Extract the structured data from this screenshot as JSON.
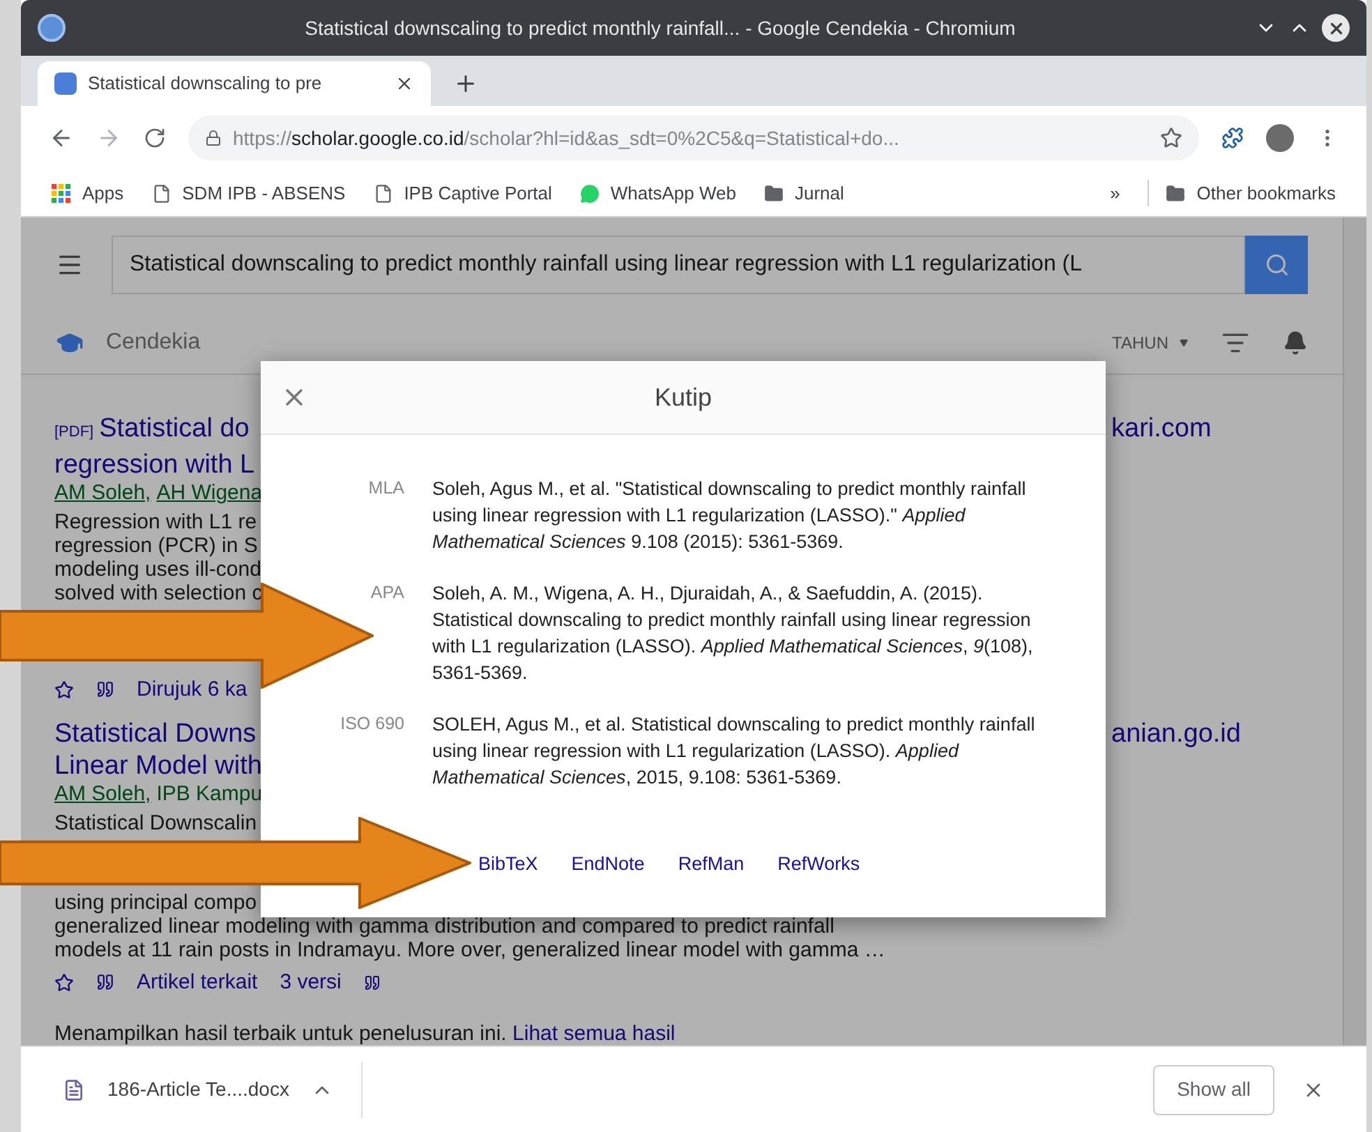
{
  "window": {
    "title": "Statistical downscaling to predict monthly rainfall... - Google Cendekia - Chromium"
  },
  "tabs": [
    {
      "label": "Statistical downscaling to pre",
      "selected": true
    }
  ],
  "address_bar": {
    "scheme": "https://",
    "host": "scholar.google.co.id",
    "path": "/scholar?hl=id&as_sdt=0%2C5&q=Statistical+do..."
  },
  "bookmarks": [
    {
      "kind": "apps",
      "label": "Apps"
    },
    {
      "kind": "page",
      "label": "SDM IPB - ABSENS"
    },
    {
      "kind": "page",
      "label": "IPB Captive Portal"
    },
    {
      "kind": "chat",
      "label": "WhatsApp Web"
    },
    {
      "kind": "folder",
      "label": "Jurnal"
    }
  ],
  "bookmarks_overflow": "»",
  "other_bookmarks": "Other bookmarks",
  "search": {
    "value": "Statistical downscaling to predict monthly rainfall using linear regression with L1 regularization (L"
  },
  "brand": "Cendekia",
  "year_filter": "TAHUN",
  "results": [
    {
      "pdf_tag": "[PDF]",
      "title_lines": [
        "Statistical do",
        "regression with L"
      ],
      "source": "kari.com",
      "authors": [
        {
          "name": "AM Soleh,",
          "link": true
        },
        {
          "name": "AH Wigena",
          "link": true
        }
      ],
      "snippet_blocks": [
        [
          "Regression with L1 re",
          "regression (PCR) in S",
          "modeling uses ill-cond",
          "solved with selection c"
        ]
      ],
      "actions": [
        "Dirujuk 6 ka"
      ]
    },
    {
      "title_lines": [
        "Statistical Downs",
        "Linear Model with"
      ],
      "source": "anian.go.id",
      "authors": [
        {
          "name": "AM Soleh,",
          "link": true
        },
        {
          "name": "IPB Kampu",
          "link": false
        }
      ],
      "snippet_blocks": [
        [
          "Statistical Downscalin"
        ],
        [
          "using principal compo",
          "generalized linear modeling with gamma distribution and compared to predict rainfall",
          "models at 11 rain posts in Indramayu. More over, generalized linear model with gamma …"
        ]
      ],
      "actions": [
        "Artikel terkait",
        "3 versi"
      ]
    }
  ],
  "footer": {
    "text": "Menampilkan hasil terbaik untuk penelusuran ini.",
    "link": "Lihat semua hasil"
  },
  "dialog": {
    "title": "Kutip",
    "citations": [
      {
        "style": "MLA",
        "text": "Soleh, Agus M., et al. \"Statistical downscaling to predict monthly rainfall using linear regression with L1 regularization (LASSO).\" *Applied Mathematical Sciences* 9.108 (2015): 5361-5369."
      },
      {
        "style": "APA",
        "text": "Soleh, A. M., Wigena, A. H., Djuraidah, A., & Saefuddin, A. (2015). Statistical downscaling to predict monthly rainfall using linear regression with L1 regularization (LASSO). *Applied Mathematical Sciences*, *9*(108), 5361-5369."
      },
      {
        "style": "ISO 690",
        "text": "SOLEH, Agus M., et al. Statistical downscaling to predict monthly rainfall using linear regression with L1 regularization (LASSO). *Applied Mathematical Sciences*, 2015, 9.108: 5361-5369."
      }
    ],
    "export_links": [
      "BibTeX",
      "EndNote",
      "RefMan",
      "RefWorks"
    ]
  },
  "download": {
    "file": "186-Article Te....docx",
    "show_all": "Show all"
  }
}
